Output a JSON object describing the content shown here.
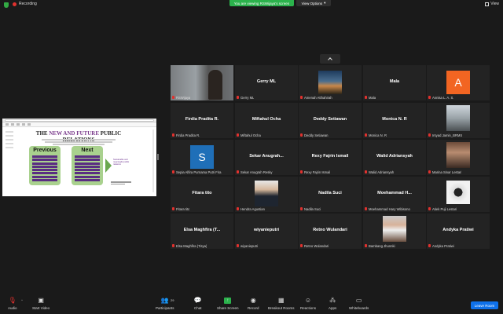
{
  "topbar": {
    "recording": "Recording",
    "viewing_banner": "You are viewing RSWijaya's screen",
    "view_options": "View Options",
    "view": "View"
  },
  "shared_screen": {
    "title_prefix": "THE ",
    "title_accent": "NEW AND FUTURE",
    "title_suffix": " PUBLIC RELATIONS",
    "previous": "Previous",
    "next": "Next",
    "arrow_caption": "Sustainable and meaningful public relations"
  },
  "gallery": [
    {
      "name": "",
      "caption": "RSWijaya",
      "kind": "video-man"
    },
    {
      "name": "Gerry ML",
      "caption": "Gerry ML",
      "kind": "name"
    },
    {
      "name": "",
      "caption": "Amenah Atthahirah",
      "kind": "sunset"
    },
    {
      "name": "Mala",
      "caption": "Mala",
      "kind": "name"
    },
    {
      "name": "",
      "caption": "Annisa L. A. S.",
      "kind": "letter",
      "letter": "A",
      "color": "#f26522"
    },
    {
      "name": "Firdia Pradita R.",
      "caption": "Firdia Pradita R.",
      "kind": "name"
    },
    {
      "name": "Miftahul Ocha",
      "caption": "Miftahul Ocha",
      "kind": "name"
    },
    {
      "name": "Deddy Setiawan",
      "caption": "Deddy Setiawan",
      "kind": "name"
    },
    {
      "name": "Monica N. R",
      "caption": "Monica N. R",
      "kind": "name"
    },
    {
      "name": "",
      "caption": "Irsyad Jamin_BRMS",
      "kind": "photo-street"
    },
    {
      "name": "",
      "caption": "Sepia Alfira Purnama Putri Fira",
      "kind": "letter",
      "letter": "S",
      "color": "#1f6fb8"
    },
    {
      "name": "Sekar Anugrah...",
      "caption": "Sekar Anugrah Resky",
      "kind": "name"
    },
    {
      "name": "Rexy Fajrin Ismail",
      "caption": "Rexy Fajrin Ismail",
      "kind": "name"
    },
    {
      "name": "Walid Adriansyah",
      "caption": "Walid Adriansyah",
      "kind": "name"
    },
    {
      "name": "",
      "caption": "Marina Sinar Lestari",
      "kind": "photo-girl"
    },
    {
      "name": "Fitara tito",
      "caption": "Fitara tito",
      "kind": "name"
    },
    {
      "name": "",
      "caption": "Hendra Agustian",
      "kind": "photo-suit"
    },
    {
      "name": "Nadila Suci",
      "caption": "Nadila Suci",
      "kind": "name"
    },
    {
      "name": "Moehammad H...",
      "caption": "Moehammad Hary Wibisono",
      "kind": "name"
    },
    {
      "name": "",
      "caption": "Atiek Puji Lestari",
      "kind": "photo-camera"
    },
    {
      "name": "Elsa Maghfira (T...",
      "caption": "Elsa Maghfira (Tisya)",
      "kind": "name"
    },
    {
      "name": "wiyanieputri",
      "caption": "wiyanieputri",
      "kind": "name"
    },
    {
      "name": "Retno Wulandari",
      "caption": "Retno Wulandari",
      "kind": "name"
    },
    {
      "name": "",
      "caption": "Bambang Jhunnki",
      "kind": "photo-mask"
    },
    {
      "name": "Andyka Pratiwi",
      "caption": "Andyka Pratiwi",
      "kind": "name"
    }
  ],
  "toolbar": {
    "audio": "Audio",
    "start_video": "Start Video",
    "participants": "Participants",
    "participants_count": "29",
    "chat": "Chat",
    "share_screen": "Share Screen",
    "record": "Record",
    "breakout_rooms": "Breakout Rooms",
    "reactions": "Reactions",
    "apps": "Apps",
    "whiteboards": "Whiteboards",
    "leave_room": "Leave Room"
  }
}
